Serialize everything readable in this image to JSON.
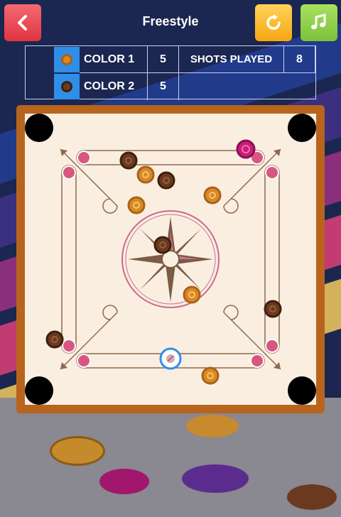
{
  "header": {
    "title": "Freestyle",
    "back_icon": "chevron-left-icon",
    "restart_icon": "restart-icon",
    "music_icon": "music-note-icon"
  },
  "scoreboard": {
    "player1": {
      "label": "COLOR 1",
      "score": "5",
      "piece_color": "#d98a24"
    },
    "player2": {
      "label": "COLOR 2",
      "score": "5",
      "piece_color": "#6b3a1e"
    },
    "shots_label": "SHOTS PLAYED",
    "shots_value": "8"
  },
  "colors": {
    "back": "#e0343f",
    "restart": "#f5a712",
    "music": "#7cc13a",
    "board_frame": "#b8641d",
    "board_surface": "#faeee0",
    "light_coin": "#d98a24",
    "dark_coin": "#6b3a1e",
    "queen": "#c71f7a",
    "striker": "#2f8ee8"
  }
}
